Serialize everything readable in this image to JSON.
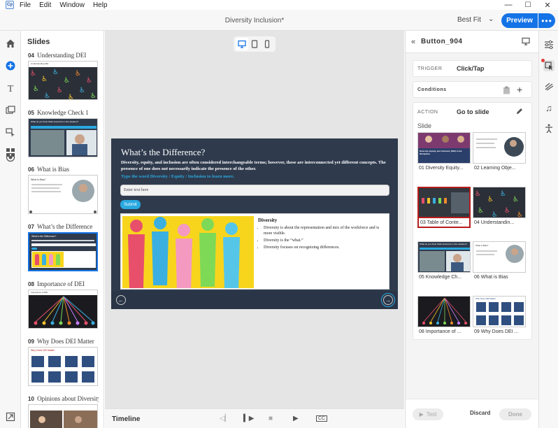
{
  "menu": {
    "app_logo": "Cp",
    "items": [
      "File",
      "Edit",
      "Window",
      "Help"
    ]
  },
  "window": {
    "minimize": "—",
    "maximize": "☐",
    "close": "✕"
  },
  "toolbar": {
    "doc_title": "Diversity Inclusion*",
    "zoom": "Best Fit",
    "preview": "Preview",
    "more": "•••"
  },
  "slides_panel": {
    "heading": "Slides",
    "items": [
      {
        "num": "04",
        "title": "Understanding DEI",
        "thumb_title": "Understanding DEI"
      },
      {
        "num": "05",
        "title": "Knowledge Check 1",
        "thumb_title": "What do you think Shah should do in this situation?"
      },
      {
        "num": "06",
        "title": "What is Bias",
        "thumb_title": "What is Bias?"
      },
      {
        "num": "07",
        "title": "What’s the Difference",
        "thumb_title": "What’s the Difference?"
      },
      {
        "num": "08",
        "title": "Importance of DEI",
        "thumb_title": "Importance of DEI"
      },
      {
        "num": "09",
        "title": "Why Does DEI Matter",
        "thumb_title": "Why Does DEI Matter"
      },
      {
        "num": "10",
        "title": "Opinions about Diversity",
        "thumb_title": ""
      }
    ]
  },
  "slide": {
    "title": "What’s the Difference?",
    "body": "Diversity, equity, and inclusion are often considered interchangeable terms; however, these are interconnected yet different concepts. The presence of one does not necessarily indicate the presence of the other.",
    "hint": "Type the word Diversity / Equity / Inclusion to learn more.",
    "input_placeholder": "Enter text here",
    "submit": "Submit",
    "card_heading": "Diversity",
    "bullets": [
      "Diversity is about the representation and mix of the workforce and is more visible.",
      "Diversity is the “what.”",
      "Diversity focuses on recognizing differences."
    ],
    "nav_prev": "←",
    "nav_next": "→"
  },
  "timeline": {
    "label": "Timeline"
  },
  "right_panel": {
    "object_name": "Button_904",
    "trigger_label": "TRIGGER",
    "trigger_value": "Click/Tap",
    "conditions_label": "Conditions",
    "action_label": "ACTION",
    "action_value": "Go to slide",
    "slide_label": "Slide",
    "slides": [
      {
        "label": "01 Diversity Equity...",
        "thumb_title": "Diversity, Equity, and Inclusion (DEI) in the Workplace"
      },
      {
        "label": "02 Learning Obje...",
        "thumb_title": ""
      },
      {
        "label": "03 Table of Conte...",
        "thumb_title": ""
      },
      {
        "label": "04 Understandin...",
        "thumb_title": ""
      },
      {
        "label": "05 Knowledge Ch...",
        "thumb_title": "What do you think Shah should do in this situation?"
      },
      {
        "label": "06 What is Bias",
        "thumb_title": "What is Bias?"
      },
      {
        "label": "08 Importance of ...",
        "thumb_title": ""
      },
      {
        "label": "09 Why Does DEI ...",
        "thumb_title": "Why Does DEI Matter"
      }
    ],
    "selected_slide": "03 Table of Conte...",
    "test": "Test",
    "discard": "Discard",
    "done": "Done"
  },
  "colors": {
    "accent": "#1473e6",
    "selection_red": "#b81c1c",
    "slide_bg": "#2f3b4d",
    "link_blue": "#29a8e0"
  }
}
